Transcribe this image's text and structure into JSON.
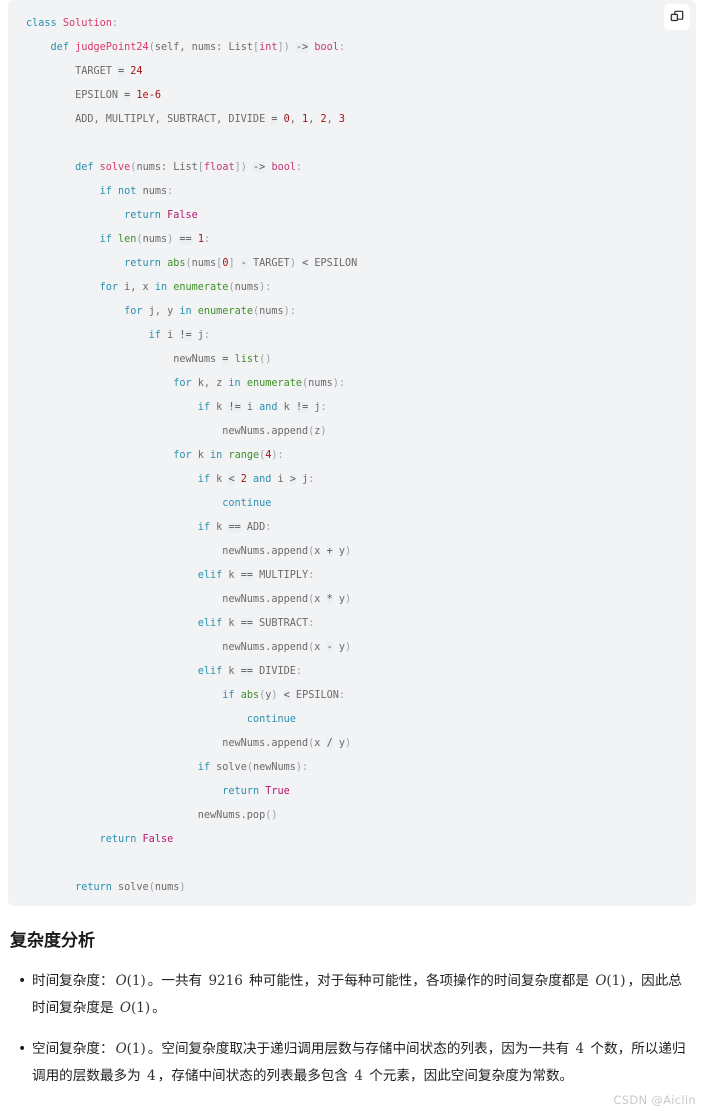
{
  "code_block": {
    "language": "python",
    "copy_button_label": "copy-code",
    "background_color": "#f2f3f5",
    "lines": [
      [
        {
          "t": "class ",
          "c": "kw"
        },
        {
          "t": "Solution",
          "c": "cls"
        },
        {
          "t": ":",
          "c": "pn"
        }
      ],
      [
        {
          "t": "    ",
          "c": "pl"
        },
        {
          "t": "def ",
          "c": "kw"
        },
        {
          "t": "judgePoint24",
          "c": "fn"
        },
        {
          "t": "(",
          "c": "pn"
        },
        {
          "t": "self, nums: List",
          "c": "pl"
        },
        {
          "t": "[",
          "c": "pn"
        },
        {
          "t": "int",
          "c": "typ"
        },
        {
          "t": "]",
          "c": "pn"
        },
        {
          "t": ")",
          "c": "pn"
        },
        {
          "t": " ",
          "c": "pl"
        },
        {
          "t": "->",
          "c": "op"
        },
        {
          "t": " ",
          "c": "pl"
        },
        {
          "t": "bool",
          "c": "typ"
        },
        {
          "t": ":",
          "c": "pn"
        }
      ],
      [
        {
          "t": "        TARGET ",
          "c": "pl"
        },
        {
          "t": "=",
          "c": "op"
        },
        {
          "t": " ",
          "c": "pl"
        },
        {
          "t": "24",
          "c": "num"
        }
      ],
      [
        {
          "t": "        EPSILON ",
          "c": "pl"
        },
        {
          "t": "=",
          "c": "op"
        },
        {
          "t": " ",
          "c": "pl"
        },
        {
          "t": "1e-6",
          "c": "num"
        }
      ],
      [
        {
          "t": "        ADD, MULTIPLY, SUBTRACT, DIVIDE ",
          "c": "pl"
        },
        {
          "t": "=",
          "c": "op"
        },
        {
          "t": " ",
          "c": "pl"
        },
        {
          "t": "0",
          "c": "num"
        },
        {
          "t": ", ",
          "c": "pl"
        },
        {
          "t": "1",
          "c": "num"
        },
        {
          "t": ", ",
          "c": "pl"
        },
        {
          "t": "2",
          "c": "num"
        },
        {
          "t": ", ",
          "c": "pl"
        },
        {
          "t": "3",
          "c": "num"
        }
      ],
      [],
      [
        {
          "t": "        ",
          "c": "pl"
        },
        {
          "t": "def ",
          "c": "kw"
        },
        {
          "t": "solve",
          "c": "fn"
        },
        {
          "t": "(",
          "c": "pn"
        },
        {
          "t": "nums: List",
          "c": "pl"
        },
        {
          "t": "[",
          "c": "pn"
        },
        {
          "t": "float",
          "c": "typ"
        },
        {
          "t": "]",
          "c": "pn"
        },
        {
          "t": ")",
          "c": "pn"
        },
        {
          "t": " ",
          "c": "pl"
        },
        {
          "t": "->",
          "c": "op"
        },
        {
          "t": " ",
          "c": "pl"
        },
        {
          "t": "bool",
          "c": "typ"
        },
        {
          "t": ":",
          "c": "pn"
        }
      ],
      [
        {
          "t": "            ",
          "c": "pl"
        },
        {
          "t": "if ",
          "c": "kw"
        },
        {
          "t": "not ",
          "c": "kw"
        },
        {
          "t": "nums",
          "c": "pl"
        },
        {
          "t": ":",
          "c": "pn"
        }
      ],
      [
        {
          "t": "                ",
          "c": "pl"
        },
        {
          "t": "return ",
          "c": "kw"
        },
        {
          "t": "False",
          "c": "lit"
        }
      ],
      [
        {
          "t": "            ",
          "c": "pl"
        },
        {
          "t": "if ",
          "c": "kw"
        },
        {
          "t": "len",
          "c": "bi"
        },
        {
          "t": "(",
          "c": "pn"
        },
        {
          "t": "nums",
          "c": "pl"
        },
        {
          "t": ")",
          "c": "pn"
        },
        {
          "t": " ",
          "c": "pl"
        },
        {
          "t": "==",
          "c": "op"
        },
        {
          "t": " ",
          "c": "pl"
        },
        {
          "t": "1",
          "c": "num"
        },
        {
          "t": ":",
          "c": "pn"
        }
      ],
      [
        {
          "t": "                ",
          "c": "pl"
        },
        {
          "t": "return ",
          "c": "kw"
        },
        {
          "t": "abs",
          "c": "bi"
        },
        {
          "t": "(",
          "c": "pn"
        },
        {
          "t": "nums",
          "c": "pl"
        },
        {
          "t": "[",
          "c": "pn"
        },
        {
          "t": "0",
          "c": "num"
        },
        {
          "t": "]",
          "c": "pn"
        },
        {
          "t": " ",
          "c": "pl"
        },
        {
          "t": "-",
          "c": "op"
        },
        {
          "t": " TARGET",
          "c": "pl"
        },
        {
          "t": ")",
          "c": "pn"
        },
        {
          "t": " ",
          "c": "pl"
        },
        {
          "t": "<",
          "c": "op"
        },
        {
          "t": " EPSILON",
          "c": "pl"
        }
      ],
      [
        {
          "t": "            ",
          "c": "pl"
        },
        {
          "t": "for ",
          "c": "kw"
        },
        {
          "t": "i, x ",
          "c": "pl"
        },
        {
          "t": "in ",
          "c": "kw"
        },
        {
          "t": "enumerate",
          "c": "bi"
        },
        {
          "t": "(",
          "c": "pn"
        },
        {
          "t": "nums",
          "c": "pl"
        },
        {
          "t": ")",
          "c": "pn"
        },
        {
          "t": ":",
          "c": "pn"
        }
      ],
      [
        {
          "t": "                ",
          "c": "pl"
        },
        {
          "t": "for ",
          "c": "kw"
        },
        {
          "t": "j, y ",
          "c": "pl"
        },
        {
          "t": "in ",
          "c": "kw"
        },
        {
          "t": "enumerate",
          "c": "bi"
        },
        {
          "t": "(",
          "c": "pn"
        },
        {
          "t": "nums",
          "c": "pl"
        },
        {
          "t": ")",
          "c": "pn"
        },
        {
          "t": ":",
          "c": "pn"
        }
      ],
      [
        {
          "t": "                    ",
          "c": "pl"
        },
        {
          "t": "if ",
          "c": "kw"
        },
        {
          "t": "i ",
          "c": "pl"
        },
        {
          "t": "!=",
          "c": "op"
        },
        {
          "t": " j",
          "c": "pl"
        },
        {
          "t": ":",
          "c": "pn"
        }
      ],
      [
        {
          "t": "                        newNums ",
          "c": "pl"
        },
        {
          "t": "=",
          "c": "op"
        },
        {
          "t": " ",
          "c": "pl"
        },
        {
          "t": "list",
          "c": "bi"
        },
        {
          "t": "(",
          "c": "pn"
        },
        {
          "t": ")",
          "c": "pn"
        }
      ],
      [
        {
          "t": "                        ",
          "c": "pl"
        },
        {
          "t": "for ",
          "c": "kw"
        },
        {
          "t": "k, z ",
          "c": "pl"
        },
        {
          "t": "in ",
          "c": "kw"
        },
        {
          "t": "enumerate",
          "c": "bi"
        },
        {
          "t": "(",
          "c": "pn"
        },
        {
          "t": "nums",
          "c": "pl"
        },
        {
          "t": ")",
          "c": "pn"
        },
        {
          "t": ":",
          "c": "pn"
        }
      ],
      [
        {
          "t": "                            ",
          "c": "pl"
        },
        {
          "t": "if ",
          "c": "kw"
        },
        {
          "t": "k ",
          "c": "pl"
        },
        {
          "t": "!=",
          "c": "op"
        },
        {
          "t": " i ",
          "c": "pl"
        },
        {
          "t": "and ",
          "c": "kw"
        },
        {
          "t": "k ",
          "c": "pl"
        },
        {
          "t": "!=",
          "c": "op"
        },
        {
          "t": " j",
          "c": "pl"
        },
        {
          "t": ":",
          "c": "pn"
        }
      ],
      [
        {
          "t": "                                newNums.append",
          "c": "pl"
        },
        {
          "t": "(",
          "c": "pn"
        },
        {
          "t": "z",
          "c": "pl"
        },
        {
          "t": ")",
          "c": "pn"
        }
      ],
      [
        {
          "t": "                        ",
          "c": "pl"
        },
        {
          "t": "for ",
          "c": "kw"
        },
        {
          "t": "k ",
          "c": "pl"
        },
        {
          "t": "in ",
          "c": "kw"
        },
        {
          "t": "range",
          "c": "bi"
        },
        {
          "t": "(",
          "c": "pn"
        },
        {
          "t": "4",
          "c": "num"
        },
        {
          "t": ")",
          "c": "pn"
        },
        {
          "t": ":",
          "c": "pn"
        }
      ],
      [
        {
          "t": "                            ",
          "c": "pl"
        },
        {
          "t": "if ",
          "c": "kw"
        },
        {
          "t": "k ",
          "c": "pl"
        },
        {
          "t": "<",
          "c": "op"
        },
        {
          "t": " ",
          "c": "pl"
        },
        {
          "t": "2",
          "c": "num"
        },
        {
          "t": " ",
          "c": "pl"
        },
        {
          "t": "and ",
          "c": "kw"
        },
        {
          "t": "i ",
          "c": "pl"
        },
        {
          "t": ">",
          "c": "op"
        },
        {
          "t": " j",
          "c": "pl"
        },
        {
          "t": ":",
          "c": "pn"
        }
      ],
      [
        {
          "t": "                                ",
          "c": "pl"
        },
        {
          "t": "continue",
          "c": "kw"
        }
      ],
      [
        {
          "t": "                            ",
          "c": "pl"
        },
        {
          "t": "if ",
          "c": "kw"
        },
        {
          "t": "k ",
          "c": "pl"
        },
        {
          "t": "==",
          "c": "op"
        },
        {
          "t": " ADD",
          "c": "pl"
        },
        {
          "t": ":",
          "c": "pn"
        }
      ],
      [
        {
          "t": "                                newNums.append",
          "c": "pl"
        },
        {
          "t": "(",
          "c": "pn"
        },
        {
          "t": "x ",
          "c": "pl"
        },
        {
          "t": "+",
          "c": "op"
        },
        {
          "t": " y",
          "c": "pl"
        },
        {
          "t": ")",
          "c": "pn"
        }
      ],
      [
        {
          "t": "                            ",
          "c": "pl"
        },
        {
          "t": "elif ",
          "c": "kw"
        },
        {
          "t": "k ",
          "c": "pl"
        },
        {
          "t": "==",
          "c": "op"
        },
        {
          "t": " MULTIPLY",
          "c": "pl"
        },
        {
          "t": ":",
          "c": "pn"
        }
      ],
      [
        {
          "t": "                                newNums.append",
          "c": "pl"
        },
        {
          "t": "(",
          "c": "pn"
        },
        {
          "t": "x ",
          "c": "pl"
        },
        {
          "t": "*",
          "c": "op"
        },
        {
          "t": " y",
          "c": "pl"
        },
        {
          "t": ")",
          "c": "pn"
        }
      ],
      [
        {
          "t": "                            ",
          "c": "pl"
        },
        {
          "t": "elif ",
          "c": "kw"
        },
        {
          "t": "k ",
          "c": "pl"
        },
        {
          "t": "==",
          "c": "op"
        },
        {
          "t": " SUBTRACT",
          "c": "pl"
        },
        {
          "t": ":",
          "c": "pn"
        }
      ],
      [
        {
          "t": "                                newNums.append",
          "c": "pl"
        },
        {
          "t": "(",
          "c": "pn"
        },
        {
          "t": "x ",
          "c": "pl"
        },
        {
          "t": "-",
          "c": "op"
        },
        {
          "t": " y",
          "c": "pl"
        },
        {
          "t": ")",
          "c": "pn"
        }
      ],
      [
        {
          "t": "                            ",
          "c": "pl"
        },
        {
          "t": "elif ",
          "c": "kw"
        },
        {
          "t": "k ",
          "c": "pl"
        },
        {
          "t": "==",
          "c": "op"
        },
        {
          "t": " DIVIDE",
          "c": "pl"
        },
        {
          "t": ":",
          "c": "pn"
        }
      ],
      [
        {
          "t": "                                ",
          "c": "pl"
        },
        {
          "t": "if ",
          "c": "kw"
        },
        {
          "t": "abs",
          "c": "bi"
        },
        {
          "t": "(",
          "c": "pn"
        },
        {
          "t": "y",
          "c": "pl"
        },
        {
          "t": ")",
          "c": "pn"
        },
        {
          "t": " ",
          "c": "pl"
        },
        {
          "t": "<",
          "c": "op"
        },
        {
          "t": " EPSILON",
          "c": "pl"
        },
        {
          "t": ":",
          "c": "pn"
        }
      ],
      [
        {
          "t": "                                    ",
          "c": "pl"
        },
        {
          "t": "continue",
          "c": "kw"
        }
      ],
      [
        {
          "t": "                                newNums.append",
          "c": "pl"
        },
        {
          "t": "(",
          "c": "pn"
        },
        {
          "t": "x ",
          "c": "pl"
        },
        {
          "t": "/",
          "c": "op"
        },
        {
          "t": " y",
          "c": "pl"
        },
        {
          "t": ")",
          "c": "pn"
        }
      ],
      [
        {
          "t": "                            ",
          "c": "pl"
        },
        {
          "t": "if ",
          "c": "kw"
        },
        {
          "t": "solve",
          "c": "pl"
        },
        {
          "t": "(",
          "c": "pn"
        },
        {
          "t": "newNums",
          "c": "pl"
        },
        {
          "t": ")",
          "c": "pn"
        },
        {
          "t": ":",
          "c": "pn"
        }
      ],
      [
        {
          "t": "                                ",
          "c": "pl"
        },
        {
          "t": "return ",
          "c": "kw"
        },
        {
          "t": "True",
          "c": "lit"
        }
      ],
      [
        {
          "t": "                            newNums.pop",
          "c": "pl"
        },
        {
          "t": "(",
          "c": "pn"
        },
        {
          "t": ")",
          "c": "pn"
        }
      ],
      [
        {
          "t": "            ",
          "c": "pl"
        },
        {
          "t": "return ",
          "c": "kw"
        },
        {
          "t": "False",
          "c": "lit"
        }
      ],
      [],
      [
        {
          "t": "        ",
          "c": "pl"
        },
        {
          "t": "return ",
          "c": "kw"
        },
        {
          "t": "solve",
          "c": "pl"
        },
        {
          "t": "(",
          "c": "pn"
        },
        {
          "t": "nums",
          "c": "pl"
        },
        {
          "t": ")",
          "c": "pn"
        }
      ]
    ]
  },
  "analysis": {
    "heading": "复杂度分析",
    "items": [
      {
        "parts": [
          {
            "t": "时间复杂度：",
            "k": "text"
          },
          {
            "t": "O(1)",
            "k": "math"
          },
          {
            "t": "。一共有 ",
            "k": "text"
          },
          {
            "t": "9216",
            "k": "mnum"
          },
          {
            "t": " 种可能性，对于每种可能性，各项操作的时间复杂度都是 ",
            "k": "text"
          },
          {
            "t": "O(1)",
            "k": "math"
          },
          {
            "t": "，因此总时间复杂度是 ",
            "k": "text"
          },
          {
            "t": "O(1)",
            "k": "math"
          },
          {
            "t": "。",
            "k": "text"
          }
        ]
      },
      {
        "parts": [
          {
            "t": "空间复杂度：",
            "k": "text"
          },
          {
            "t": "O(1)",
            "k": "math"
          },
          {
            "t": "。空间复杂度取决于递归调用层数与存储中间状态的列表，因为一共有 ",
            "k": "text"
          },
          {
            "t": "4",
            "k": "mnum"
          },
          {
            "t": " 个数，所以递归调用的层数最多为 ",
            "k": "text"
          },
          {
            "t": "4",
            "k": "mnum"
          },
          {
            "t": "，存储中间状态的列表最多包含 ",
            "k": "text"
          },
          {
            "t": "4",
            "k": "mnum"
          },
          {
            "t": " 个元素，因此空间复杂度为常数。",
            "k": "text"
          }
        ]
      }
    ]
  },
  "watermark": {
    "text": "CSDN @Aiclin"
  }
}
